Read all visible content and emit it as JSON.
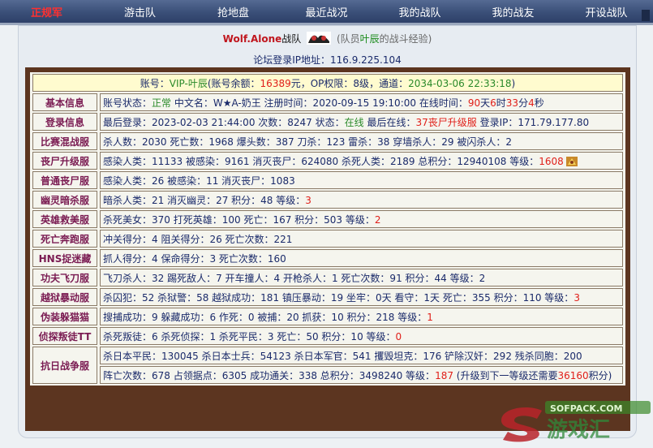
{
  "nav": {
    "items": [
      {
        "label": "正规军"
      },
      {
        "label": "游击队"
      },
      {
        "label": "抢地盘"
      },
      {
        "label": "最近战况"
      },
      {
        "label": "我的战队"
      },
      {
        "label": "我的战友"
      },
      {
        "label": "开设战队"
      }
    ]
  },
  "header": {
    "team_name": "Wolf.Alone",
    "team_suffix": "战队",
    "member_prefix": "(队员",
    "member_name": "叶辰",
    "member_suffix": "的战斗经验)",
    "ip_label": "论坛登录IP地址：",
    "ip_value": "116.9.225.104"
  },
  "account": {
    "prefix": "账号：",
    "name": "VIP-叶辰",
    "balance_label": "(账号余额：",
    "balance": "16389",
    "balance_unit": "元，OP权限：",
    "op_level": "8级",
    "channel_label": "，通道：",
    "channel_time": "2034-03-06 22:33:18",
    "suffix": ")"
  },
  "rows": [
    {
      "label": "基本信息",
      "parts": [
        {
          "t": "账号状态："
        },
        {
          "t": "正常",
          "c": "gg"
        },
        {
          "t": " 中文名：W★A-奶王 注册时间：2020-09-15 19:10:00 在线时间："
        },
        {
          "t": "90",
          "c": "red"
        },
        {
          "t": "天"
        },
        {
          "t": "6",
          "c": "red"
        },
        {
          "t": "时"
        },
        {
          "t": "33",
          "c": "red"
        },
        {
          "t": "分"
        },
        {
          "t": "4",
          "c": "red"
        },
        {
          "t": "秒"
        }
      ]
    },
    {
      "label": "登录信息",
      "parts": [
        {
          "t": "最后登录：2023-02-03 21:44:00 次数：8247 状态："
        },
        {
          "t": "在线",
          "c": "gg"
        },
        {
          "t": " 最后在线："
        },
        {
          "t": "37丧尸升级服",
          "c": "red"
        },
        {
          "t": " 登录IP：171.79.177.80"
        }
      ]
    },
    {
      "label": "比赛混战服",
      "parts": [
        {
          "t": "杀人数：2030 死亡数：1968 爆头数：387 刀杀：123 雷杀：38 穿墙杀人：29 被闪杀人：2"
        }
      ]
    },
    {
      "label": "丧尸升级服",
      "icon": true,
      "parts": [
        {
          "t": "感染人类：11133 被感染：9161 消灭丧尸：624080 杀死人类：2189 总积分：12940108 等级："
        },
        {
          "t": "1608",
          "c": "red"
        }
      ]
    },
    {
      "label": "普通丧尸服",
      "parts": [
        {
          "t": "感染人类：26 被感染：11 消灭丧尸：1083"
        }
      ]
    },
    {
      "label": "幽灵暗杀服",
      "parts": [
        {
          "t": "暗杀人类：21 消灭幽灵：27 积分：48 等级："
        },
        {
          "t": "3",
          "c": "red"
        }
      ]
    },
    {
      "label": "英雄救美服",
      "parts": [
        {
          "t": "杀死美女：370 打死英雄：100 死亡：167 积分：503 等级："
        },
        {
          "t": "2",
          "c": "red"
        }
      ]
    },
    {
      "label": "死亡奔跑服",
      "parts": [
        {
          "t": "冲关得分：4 阻关得分：26 死亡次数：221"
        }
      ]
    },
    {
      "label": "HNS捉迷藏",
      "parts": [
        {
          "t": "抓人得分：4 保命得分：3 死亡次数：160"
        }
      ]
    },
    {
      "label": "功夫飞刀服",
      "parts": [
        {
          "t": "飞刀杀人：32 踢死敌人：7 开车撞人：4 开枪杀人：1 死亡次数：91 积分：44 等级：2"
        }
      ]
    },
    {
      "label": "越狱暴动服",
      "parts": [
        {
          "t": "杀囚犯：52 杀狱警：58 越狱成功：181 镇压暴动：19 坐牢：0天 看守：1天 死亡：355 积分：110 等级："
        },
        {
          "t": "3",
          "c": "red"
        }
      ]
    },
    {
      "label": "伪装躲猫猫",
      "parts": [
        {
          "t": "搜捕成功：9 躲藏成功：6 作死：0 被捕：20 抓获：10 积分：218 等级："
        },
        {
          "t": "1",
          "c": "red"
        }
      ]
    },
    {
      "label": "侦探叛徒TT",
      "parts": [
        {
          "t": "杀死叛徒：6 杀死侦探：1 杀死平民：3 死亡：50 积分：10 等级："
        },
        {
          "t": "0",
          "c": "red"
        }
      ]
    }
  ],
  "war_row": {
    "label": "抗日战争服",
    "line1": [
      {
        "t": "杀日本平民：130045 杀日本士兵：54123 杀日本军官：541 攫毁坦克：176 铲除汉奸：292 残杀同胞：200"
      }
    ],
    "line2": [
      {
        "t": "阵亡次数：678 占领据点：6305 成功通关：338 总积分：3498240 等级："
      },
      {
        "t": "187",
        "c": "red"
      },
      {
        "t": " (升级到下一等级还需要"
      },
      {
        "t": "36160",
        "c": "red"
      },
      {
        "t": "积分)"
      }
    ]
  },
  "watermark": {
    "text1": "SOFPACK.COM",
    "text2": "游戏汇"
  },
  "colors": {
    "nav_bg": "#3a4f78",
    "board": "#5c3520",
    "label": "#7a1b52",
    "text": "#1a2a6a",
    "red": "#e0201a",
    "green": "#1a8a1a",
    "account_bg": "#fffbcf"
  }
}
